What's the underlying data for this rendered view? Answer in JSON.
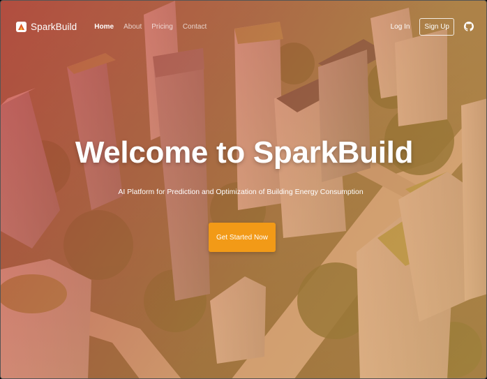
{
  "brand": {
    "name": "SparkBuild",
    "logo_icon": "spark-logo-icon"
  },
  "nav": {
    "links": [
      {
        "label": "Home",
        "active": true
      },
      {
        "label": "About",
        "active": false
      },
      {
        "label": "Pricing",
        "active": false
      },
      {
        "label": "Contact",
        "active": false
      }
    ],
    "login_label": "Log In",
    "signup_label": "Sign Up",
    "github_icon": "github-icon"
  },
  "hero": {
    "title": "Welcome to SparkBuild",
    "subtitle": "AI Platform for Prediction and Optimization of Building Energy Consumption",
    "cta_label": "Get Started Now"
  },
  "colors": {
    "overlay_start": "#cd3c37",
    "overlay_end": "#eea046",
    "cta": "#f29a17"
  }
}
